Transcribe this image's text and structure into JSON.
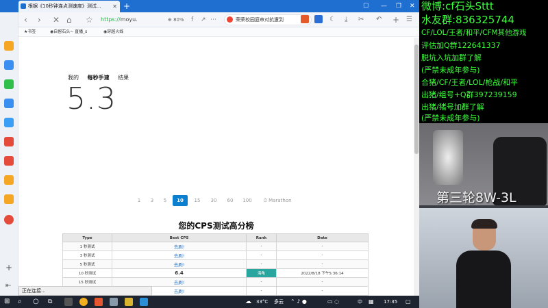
{
  "browser": {
    "tab_title": "根据《10秒钟连点测速度》测试...",
    "address_proto": "https://",
    "address_host": "moyu.",
    "zoom_level": "80%",
    "search_text": "荣荣校园庭审对抗遭到",
    "status_text": "正在连接..."
  },
  "bookmarks": {
    "items": [
      "书签",
      "自留石头~ 直播_s",
      "穿越火线"
    ]
  },
  "page": {
    "mode_tabs": [
      "我的",
      "每秒手速",
      "结果"
    ],
    "big_score": "5.3",
    "pager": [
      "1",
      "3",
      "5",
      "10",
      "15",
      "30",
      "60",
      "100",
      "Marathon"
    ],
    "pager_active": "10",
    "ranking_title": "您的CPS测试高分榜",
    "table_headers": [
      "Type",
      "Best CPS",
      "Rank",
      "Date"
    ],
    "rows": [
      {
        "type": "1 秒测试",
        "best": "去刷!",
        "rank": "-",
        "date": "-"
      },
      {
        "type": "3 秒测试",
        "best": "去刷!",
        "rank": "-",
        "date": "-"
      },
      {
        "type": "5 秒测试",
        "best": "去刷!",
        "rank": "-",
        "date": "-"
      },
      {
        "type": "10 秒测试",
        "best": "6.4",
        "rank": "海龟",
        "date": "2022/8/18 下午5:36:14"
      },
      {
        "type": "15 秒测试",
        "best": "去刷!",
        "rank": "-",
        "date": "-"
      },
      {
        "type": "",
        "best": "去刷!",
        "rank": "-",
        "date": "-"
      }
    ]
  },
  "taskbar": {
    "weather_temp": "33°C",
    "weather_desc": "多云",
    "ime": "中",
    "clock": "17:35"
  },
  "overlay": {
    "lines": [
      "微博:cf石头Sttt",
      "水友群:836325744",
      "CF/LOL/王者/和平/CFM其他游戏",
      "评估加Q群122641337",
      "脱坑入坑加群了解",
      "(严禁未成年参与)",
      "合猪/CF/王者/LOL/枪战/和平",
      "出猪/组号+Q群397239159",
      "出猪/猪号加群了解",
      "(严禁未成年参与)"
    ],
    "round_label": "第三轮8W-3L"
  }
}
